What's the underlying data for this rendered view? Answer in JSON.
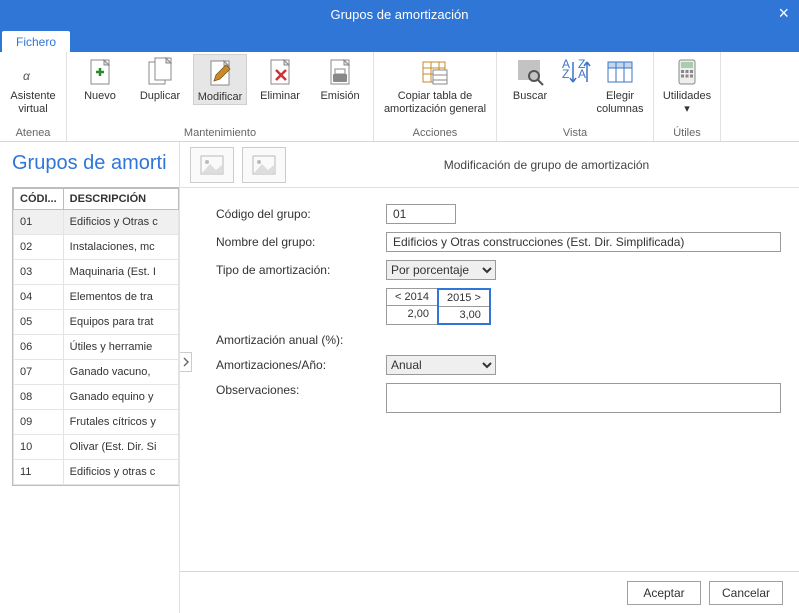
{
  "window": {
    "title": "Grupos de amortización",
    "close": "×"
  },
  "tab": {
    "label": "Fichero"
  },
  "ribbon": {
    "groups": [
      {
        "caption": "Atenea",
        "buttons": [
          {
            "label": "Asistente\nvirtual",
            "icon": "alpha"
          }
        ]
      },
      {
        "caption": "Mantenimiento",
        "buttons": [
          {
            "label": "Nuevo",
            "icon": "file-plus"
          },
          {
            "label": "Duplicar",
            "icon": "file-copy"
          },
          {
            "label": "Modificar",
            "icon": "file-edit",
            "active": true
          },
          {
            "label": "Eliminar",
            "icon": "file-delete"
          },
          {
            "label": "Emisión",
            "icon": "file-print"
          }
        ]
      },
      {
        "caption": "Acciones",
        "buttons": [
          {
            "label": "Copiar tabla de\namortización general",
            "icon": "table-copy",
            "wide": true
          }
        ]
      },
      {
        "caption": "Vista",
        "buttons": [
          {
            "label": "Buscar",
            "icon": "search"
          },
          {
            "label": "",
            "icon": "sort"
          },
          {
            "label": "Elegir\ncolumnas",
            "icon": "columns"
          }
        ]
      },
      {
        "caption": "Útiles",
        "buttons": [
          {
            "label": "Utilidades",
            "icon": "calc",
            "dropdown": true
          }
        ]
      }
    ]
  },
  "page": {
    "title": "Grupos de amorti"
  },
  "grid": {
    "headers": [
      "CÓDI...",
      "DESCRIPCIÓN"
    ],
    "rows": [
      {
        "c": "01",
        "d": "Edificios y Otras c",
        "sel": true
      },
      {
        "c": "02",
        "d": "Instalaciones, mc"
      },
      {
        "c": "03",
        "d": "Maquinaria (Est. I"
      },
      {
        "c": "04",
        "d": "Elementos de tra"
      },
      {
        "c": "05",
        "d": "Equipos para trat"
      },
      {
        "c": "06",
        "d": "Útiles y herramie"
      },
      {
        "c": "07",
        "d": "Ganado vacuno, "
      },
      {
        "c": "08",
        "d": "Ganado equino y"
      },
      {
        "c": "09",
        "d": "Frutales cítricos y"
      },
      {
        "c": "10",
        "d": "Olivar (Est. Dir. Si"
      },
      {
        "c": "11",
        "d": "Edificios y otras c"
      }
    ]
  },
  "panel": {
    "title": "Modificación de grupo de amortización"
  },
  "form": {
    "labels": {
      "codigo": "Código del grupo:",
      "nombre": "Nombre del grupo:",
      "tipo": "Tipo de amortización:",
      "anual": "Amortización anual (%):",
      "amort_ano": "Amortizaciones/Año:",
      "obs": "Observaciones:"
    },
    "values": {
      "codigo": "01",
      "nombre": "Edificios y Otras construcciones (Est. Dir. Simplificada)",
      "tipo": "Por porcentaje",
      "amort_ano": "Anual",
      "obs": ""
    },
    "years": [
      {
        "head": "< 2014",
        "val": "2,00"
      },
      {
        "head": "2015 >",
        "val": "3,00",
        "sel": true
      }
    ]
  },
  "footer": {
    "accept": "Aceptar",
    "cancel": "Cancelar"
  }
}
